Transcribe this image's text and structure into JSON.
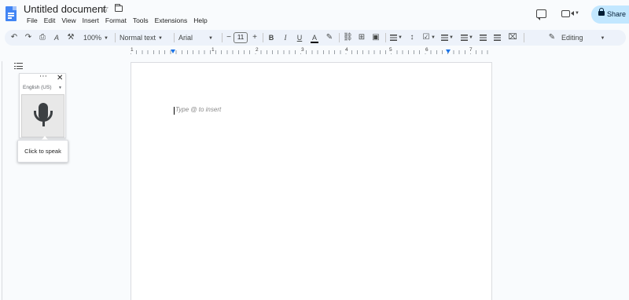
{
  "app": {
    "title": "Untitled document",
    "menu": [
      "File",
      "Edit",
      "View",
      "Insert",
      "Format",
      "Tools",
      "Extensions",
      "Help"
    ],
    "share_label": "Share"
  },
  "toolbar": {
    "zoom": "100%",
    "style": "Normal text",
    "font": "Arial",
    "font_size": "11",
    "minus": "−",
    "plus": "+",
    "bold": "B",
    "italic": "I",
    "underline": "U",
    "text_color": "A",
    "mode": "Editing"
  },
  "ruler": {
    "numbers": [
      "1",
      "1",
      "2",
      "3",
      "4",
      "5",
      "6",
      "7"
    ]
  },
  "voice_typing": {
    "language": "English (US)",
    "tooltip": "Click to speak"
  },
  "document": {
    "placeholder": "Type @ to insert"
  },
  "colors": {
    "accent": "#1a73e8",
    "share_bg": "#c2e7ff",
    "toolbar_bg": "#edf2fa",
    "doc_icon": "#4285f4"
  }
}
